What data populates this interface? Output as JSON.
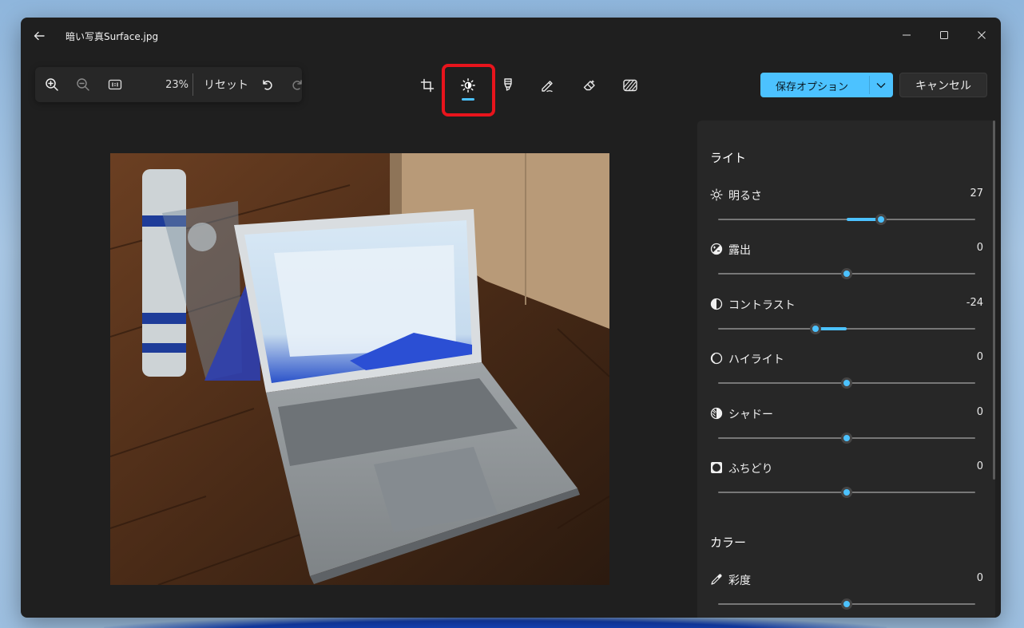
{
  "window": {
    "title": "暗い写真Surface.jpg"
  },
  "toolbar": {
    "zoom": "23%",
    "reset_label": "リセット",
    "save_label": "保存オプション",
    "cancel_label": "キャンセル",
    "active_tool": "adjust"
  },
  "icons": {
    "back": "back-arrow-icon",
    "zoom_in": "zoom-in-icon",
    "zoom_out": "zoom-out-icon",
    "actual_size": "actual-size-icon",
    "undo": "undo-icon",
    "redo": "redo-icon",
    "crop": "crop-icon",
    "adjust": "brightness-icon",
    "markup": "marker-icon",
    "draw": "pen-icon",
    "erase": "eraser-icon",
    "filter": "filter-icon"
  },
  "colors": {
    "accent": "#4cc2ff",
    "highlight": "#e8141c"
  },
  "panel": {
    "light_heading": "ライト",
    "color_heading": "カラー",
    "light": [
      {
        "key": "brightness",
        "label": "明るさ",
        "value": "27",
        "level": 27,
        "icon": "sun-icon"
      },
      {
        "key": "exposure",
        "label": "露出",
        "value": "0",
        "level": 0,
        "icon": "exposure-icon"
      },
      {
        "key": "contrast",
        "label": "コントラスト",
        "value": "-24",
        "level": -24,
        "icon": "contrast-icon"
      },
      {
        "key": "highlights",
        "label": "ハイライト",
        "value": "0",
        "level": 0,
        "icon": "highlights-icon"
      },
      {
        "key": "shadows",
        "label": "シャドー",
        "value": "0",
        "level": 0,
        "icon": "shadows-icon"
      },
      {
        "key": "vignette",
        "label": "ふちどり",
        "value": "0",
        "level": 0,
        "icon": "vignette-icon"
      }
    ],
    "color": [
      {
        "key": "saturation",
        "label": "彩度",
        "value": "0",
        "level": 0,
        "icon": "eyedropper-icon"
      }
    ],
    "slider_range": [
      -100,
      100
    ]
  }
}
